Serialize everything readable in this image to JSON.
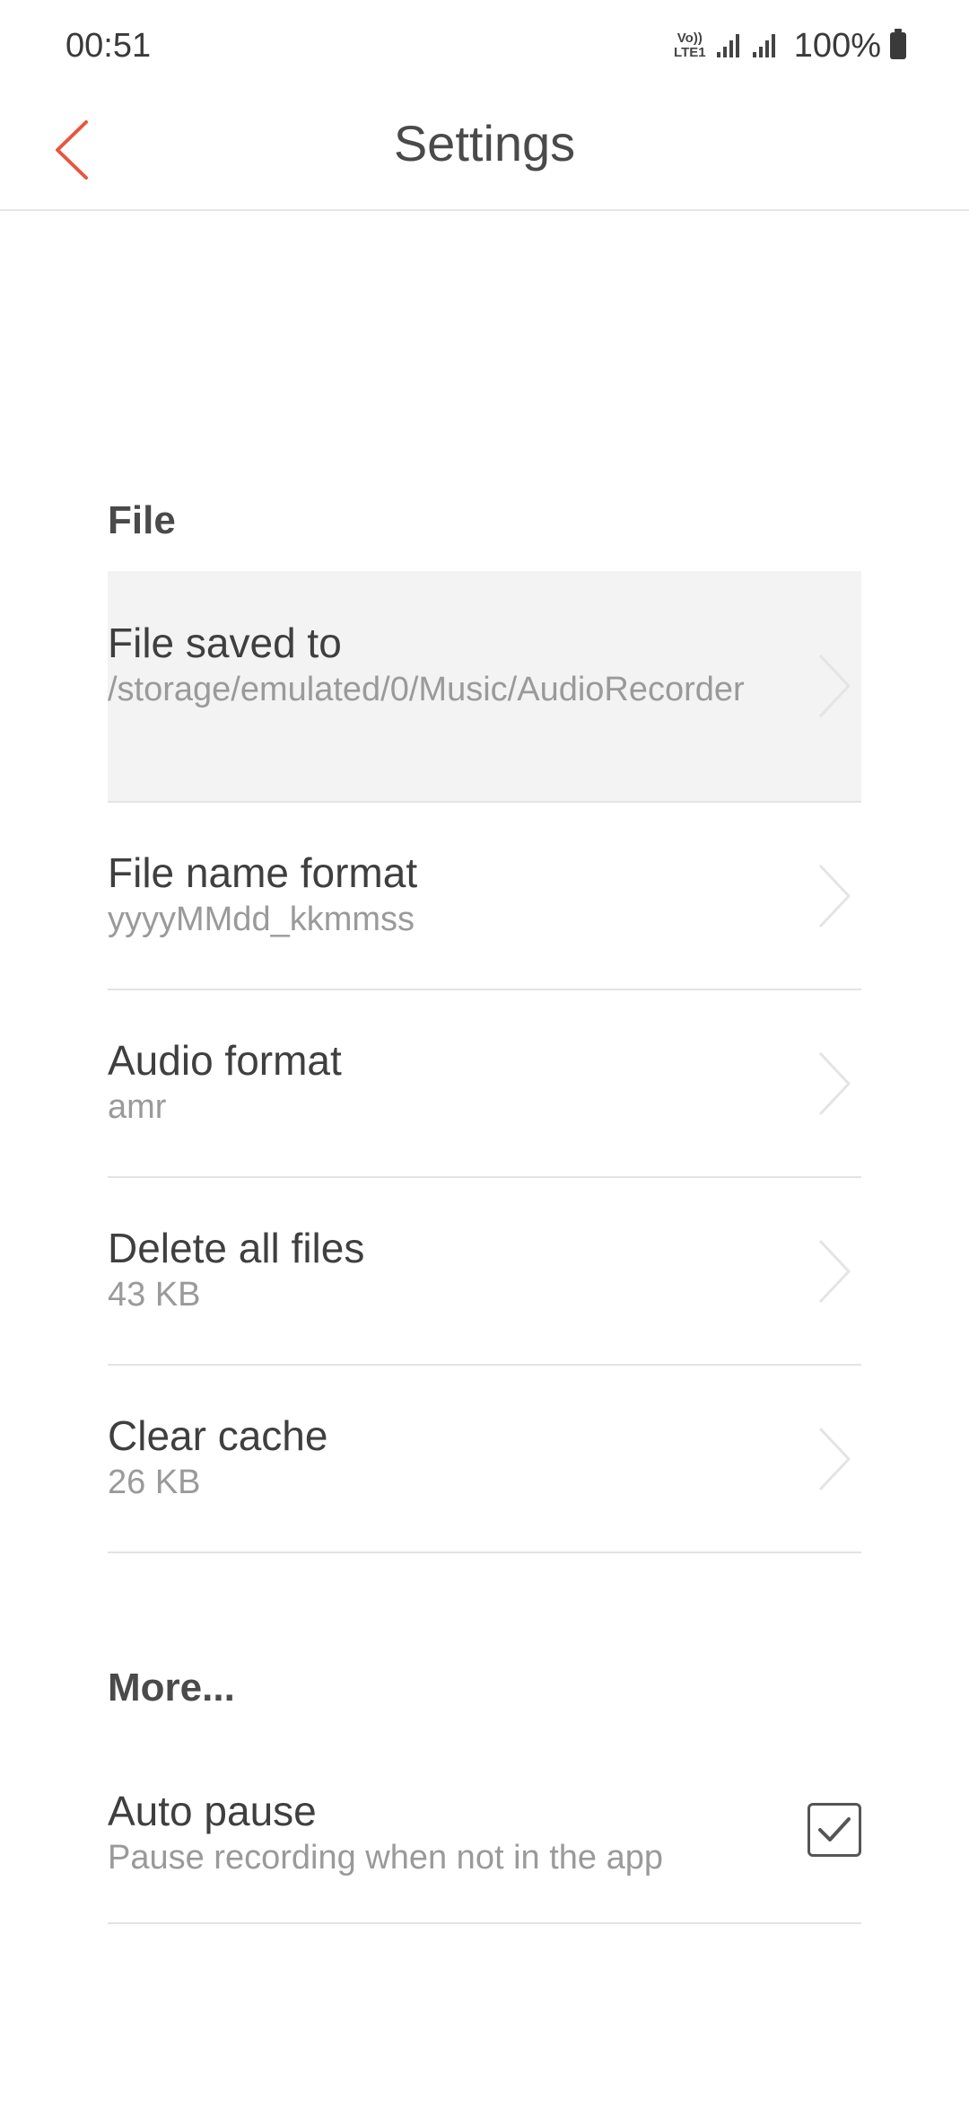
{
  "status_bar": {
    "time": "00:51",
    "network_label_top": "Vo))",
    "network_label_bottom": "LTE1",
    "battery_percent": "100%"
  },
  "header": {
    "title": "Settings",
    "accent_color": "#e8553e"
  },
  "sections": {
    "file": {
      "title": "File",
      "rows": [
        {
          "title": "File saved to",
          "value": "/storage/emulated/0/Music/AudioRecorder"
        },
        {
          "title": "File name format",
          "value": "yyyyMMdd_kkmmss"
        },
        {
          "title": "Audio format",
          "value": "amr"
        },
        {
          "title": "Delete all files",
          "value": "43 KB"
        },
        {
          "title": "Clear cache",
          "value": "26 KB"
        }
      ]
    },
    "more": {
      "title": "More...",
      "auto_pause": {
        "title": "Auto pause",
        "value": "Pause recording when not in the app",
        "checked": true
      }
    }
  },
  "icons": {
    "back": "chevron-left-icon",
    "row_arrow": "chevron-right-icon",
    "check": "checkmark-icon"
  }
}
